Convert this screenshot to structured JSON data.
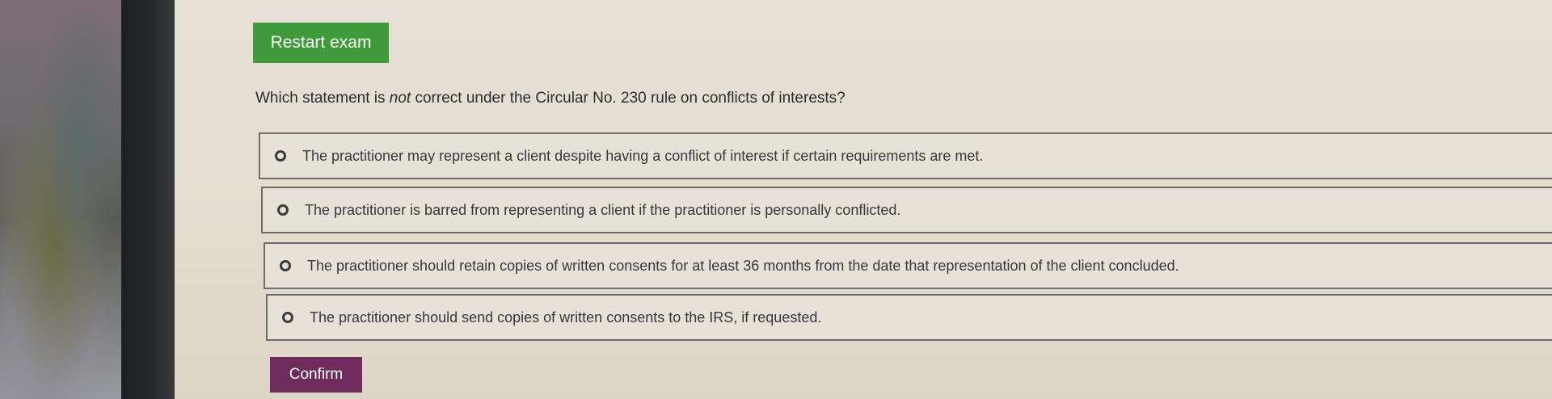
{
  "exam": {
    "restart_label": "Restart exam",
    "question_prefix": "Which statement is ",
    "question_emphasis": "not",
    "question_suffix": " correct under the Circular No. 230 rule on conflicts of interests?",
    "options": [
      {
        "label": "The practitioner may represent a client despite having a conflict of interest if certain requirements are met."
      },
      {
        "label": "The practitioner is barred from representing a client if the practitioner is personally conflicted."
      },
      {
        "label": "The practitioner should retain copies of written consents for at least 36 months from the date that representation of the client concluded."
      },
      {
        "label": "The practitioner should send copies of written consents to the IRS, if requested."
      }
    ],
    "confirm_label": "Confirm"
  },
  "colors": {
    "restart_button": "#3f9a3a",
    "confirm_button": "#6e2b5c",
    "page_background": "#e4ddd1"
  }
}
